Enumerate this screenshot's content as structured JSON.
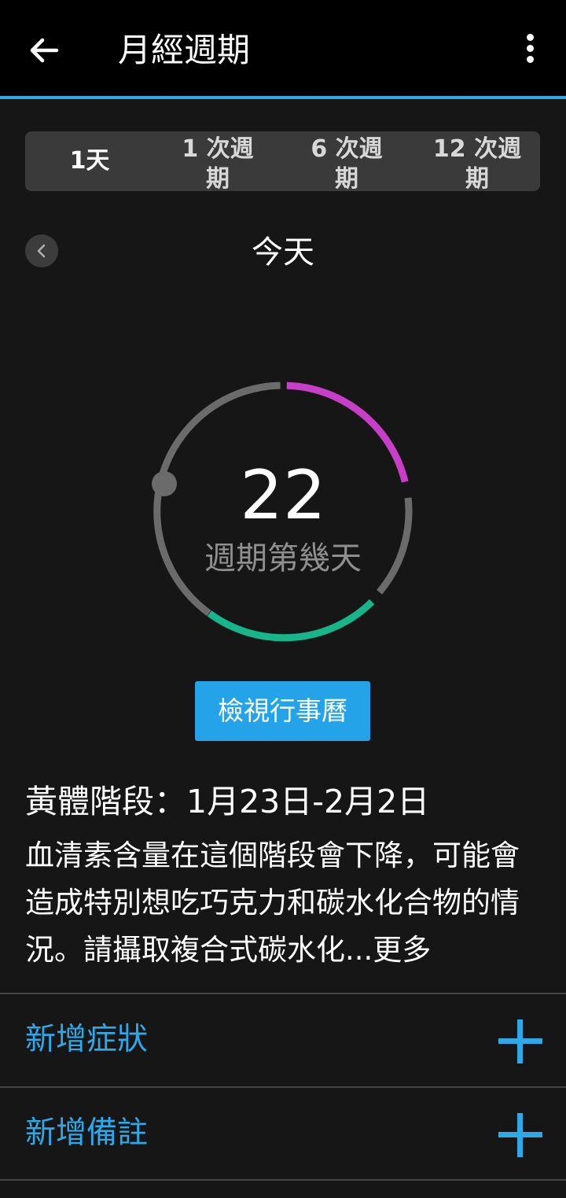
{
  "header": {
    "title": "月經週期",
    "back_icon": "arrow-left-icon",
    "menu_icon": "more-vertical-icon"
  },
  "tabs": [
    {
      "label": "1天",
      "active": true
    },
    {
      "label": "1 次週期",
      "active": false
    },
    {
      "label": "6 次週期",
      "active": false
    },
    {
      "label": "12 次週期",
      "active": false
    }
  ],
  "nav": {
    "date_label": "今天",
    "prev_icon": "chevron-left-icon"
  },
  "cycle": {
    "day_number": "22",
    "day_label": "週期第幾天",
    "colors": {
      "track": "#6b6b6b",
      "fertile": "#c63fc6",
      "period": "#16b68a",
      "marker": "#6b6b6b"
    }
  },
  "calendar_button": "檢視行事曆",
  "phase": {
    "title": "黃體階段：1月23日-2月2日",
    "description": "血清素含量在這個階段會下降，可能會造成特別想吃巧克力和碳水化合物的情況。請攝取複合式碳水化...更多"
  },
  "actions": [
    {
      "label": "新增症狀",
      "icon": "plus-icon"
    },
    {
      "label": "新增備註",
      "icon": "plus-icon"
    }
  ]
}
